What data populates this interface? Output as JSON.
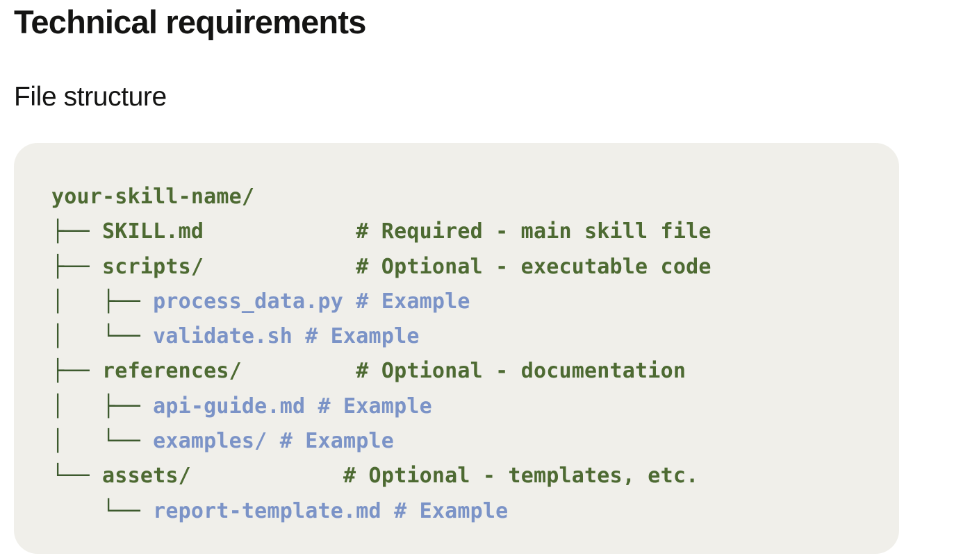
{
  "page": {
    "heading": "Technical requirements",
    "section_heading": "File structure"
  },
  "colors": {
    "background": "#ffffff",
    "code_background": "#f0efea",
    "primary_code_text": "#4d6a32",
    "example_code_text": "#7b93c7",
    "heading_text": "#141413"
  },
  "code_block": {
    "language": "text",
    "lines": [
      {
        "prefix": "",
        "name": "your-skill-name/",
        "pad": "",
        "comment": "",
        "kind": "root"
      },
      {
        "prefix": "├── ",
        "name": "SKILL.md",
        "pad": "            ",
        "comment": "# Required - main skill file",
        "kind": "main"
      },
      {
        "prefix": "├── ",
        "name": "scripts/",
        "pad": "            ",
        "comment": "# Optional - executable code",
        "kind": "main"
      },
      {
        "prefix": "│   ├── ",
        "name": "process_data.py",
        "pad": " ",
        "comment": "# Example",
        "kind": "example"
      },
      {
        "prefix": "│   └── ",
        "name": "validate.sh",
        "pad": " ",
        "comment": "# Example",
        "kind": "example"
      },
      {
        "prefix": "├── ",
        "name": "references/",
        "pad": "         ",
        "comment": "# Optional - documentation",
        "kind": "main"
      },
      {
        "prefix": "│   ├── ",
        "name": "api-guide.md",
        "pad": " ",
        "comment": "# Example",
        "kind": "example"
      },
      {
        "prefix": "│   └── ",
        "name": "examples/",
        "pad": " ",
        "comment": "# Example",
        "kind": "example"
      },
      {
        "prefix": "└── ",
        "name": "assets/",
        "pad": "            ",
        "comment": "# Optional - templates, etc.",
        "kind": "main"
      },
      {
        "prefix": "    └── ",
        "name": "report-template.md",
        "pad": " ",
        "comment": "# Example",
        "kind": "example"
      }
    ]
  }
}
